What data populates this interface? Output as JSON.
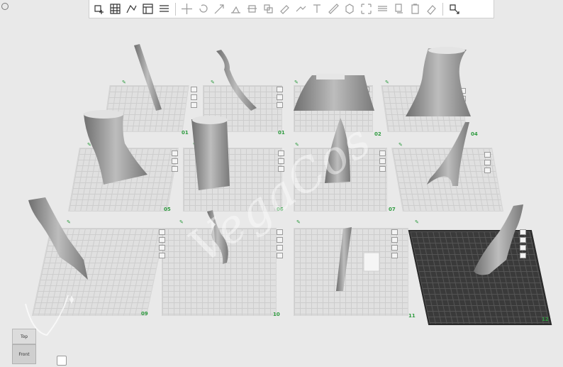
{
  "toolbar": {
    "buttons": [
      {
        "name": "add-object-icon"
      },
      {
        "name": "arrange-grid-icon"
      },
      {
        "name": "split-parts-icon"
      },
      {
        "name": "layout-icon"
      },
      {
        "name": "list-icon"
      },
      {
        "name": "move-icon"
      },
      {
        "name": "rotate-icon"
      },
      {
        "name": "scale-icon"
      },
      {
        "name": "lay-flat-icon"
      },
      {
        "name": "cut-icon"
      },
      {
        "name": "boolean-icon"
      },
      {
        "name": "paint-support-icon"
      },
      {
        "name": "paint-seam-icon"
      },
      {
        "name": "text-tool-icon"
      },
      {
        "name": "measure-icon"
      },
      {
        "name": "cube-view-icon"
      },
      {
        "name": "fit-view-icon"
      },
      {
        "name": "slice-layers-icon"
      },
      {
        "name": "copy-icon"
      },
      {
        "name": "paste-icon"
      },
      {
        "name": "eraser-icon"
      },
      {
        "name": "export-icon"
      }
    ]
  },
  "plates": [
    {
      "label": "01"
    },
    {
      "label": "01"
    },
    {
      "label": "02"
    },
    {
      "label": "04"
    },
    {
      "label": "05"
    },
    {
      "label": "06"
    },
    {
      "label": "07"
    },
    {
      "label": ""
    },
    {
      "label": "09"
    },
    {
      "label": "10"
    },
    {
      "label": "11"
    },
    {
      "label": "12"
    }
  ],
  "view_cube": {
    "top_label": "Top",
    "front_label": "Front"
  },
  "watermark": "VegaCos",
  "logo_text": "Vega Cos",
  "colors": {
    "accent": "#2e9b3f",
    "model": "#9a9a9a",
    "plate": "#e0e0e0",
    "active_plate": "#3a3a3a"
  }
}
